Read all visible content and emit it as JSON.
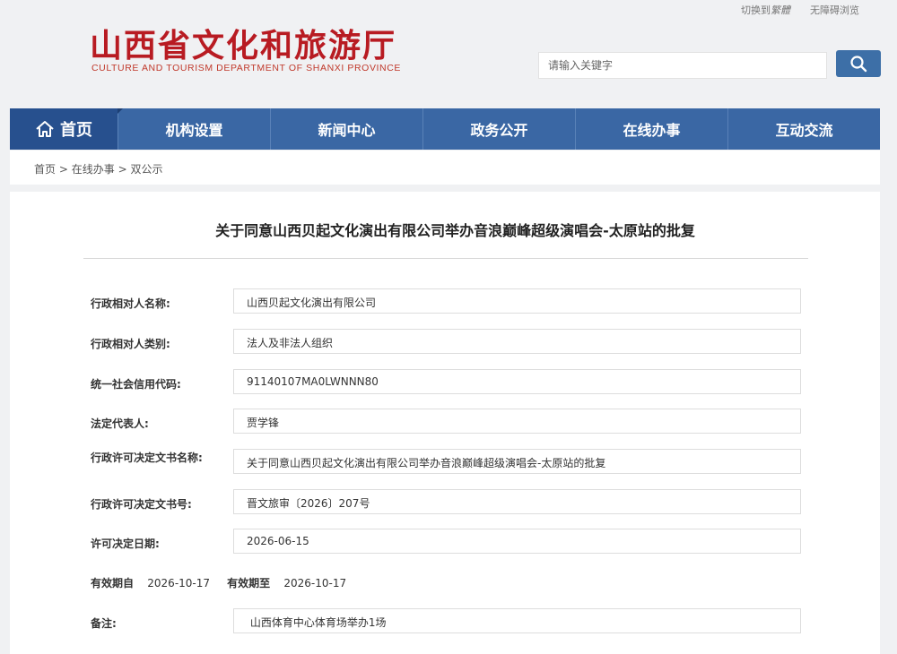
{
  "top_links": {
    "switch_prefix": "切换到",
    "switch_italic": "繁體",
    "accessible": "无障碍浏览"
  },
  "logo": {
    "cn": "山西省文化和旅游厅",
    "en": "CULTURE AND TOURISM DEPARTMENT OF SHANXI PROVINCE"
  },
  "search": {
    "placeholder": "请输入关键字",
    "icon": "search-icon"
  },
  "nav": {
    "home": "首页",
    "home_icon": "home-icon",
    "items": [
      "机构设置",
      "新闻中心",
      "政务公开",
      "在线办事",
      "互动交流"
    ]
  },
  "breadcrumb": [
    "首页",
    "在线办事",
    "双公示"
  ],
  "breadcrumb_sep": ">",
  "doc": {
    "title": "关于同意山西贝起文化演出有限公司举办音浪巅峰超级演唱会-太原站的批复",
    "fields": [
      {
        "label": "行政相对人名称:",
        "value": "山西贝起文化演出有限公司"
      },
      {
        "label": "行政相对人类别:",
        "value": "法人及非法人组织"
      },
      {
        "label": "统一社会信用代码:",
        "value": "91140107MA0LWNNN80"
      },
      {
        "label": "法定代表人:",
        "value": "贾学锋"
      },
      {
        "label": "行政许可决定文书名称:",
        "value": "关于同意山西贝起文化演出有限公司举办音浪巅峰超级演唱会-太原站的批复"
      },
      {
        "label": "行政许可决定文书号:",
        "value": "晋文旅审〔2026〕207号"
      },
      {
        "label": "许可决定日期:",
        "value": "2026-06-15"
      }
    ],
    "validity": {
      "from_label": "有效期自",
      "from_value": "2026-10-17",
      "to_label": "有效期至",
      "to_value": "2026-10-17"
    },
    "remark": {
      "label": "备注:",
      "value": " 山西体育中心体育场举办1场"
    }
  },
  "colors": {
    "brand_red": "#b81b22",
    "nav_blue": "#3a67a4",
    "home_blue": "#27508e",
    "search_btn": "#3d6fa7"
  }
}
